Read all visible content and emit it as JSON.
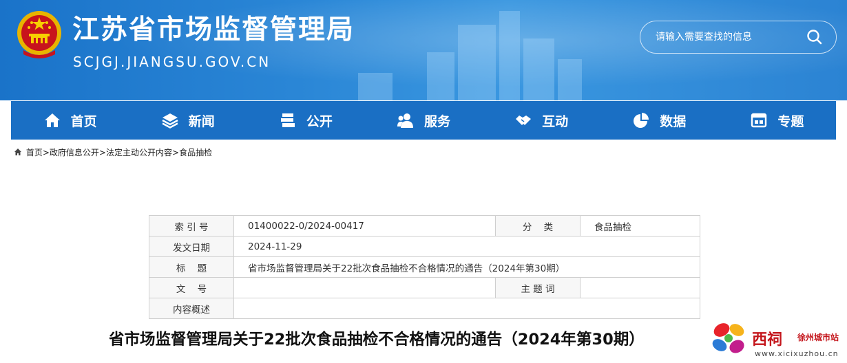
{
  "header": {
    "site_title": "江苏省市场监督管理局",
    "site_domain": "SCJGJ.JIANGSU.GOV.CN",
    "search_placeholder": "请输入需要查找的信息",
    "emblem_icon": "national-emblem-icon",
    "search_icon": "search-icon"
  },
  "nav": {
    "items": [
      {
        "label": "首页",
        "icon": "home-icon"
      },
      {
        "label": "新闻",
        "icon": "layers-icon"
      },
      {
        "label": "公开",
        "icon": "stack-icon"
      },
      {
        "label": "服务",
        "icon": "users-icon"
      },
      {
        "label": "互动",
        "icon": "handshake-icon"
      },
      {
        "label": "数据",
        "icon": "pie-chart-icon"
      },
      {
        "label": "专题",
        "icon": "window-icon"
      }
    ]
  },
  "breadcrumb": {
    "items": [
      "首页",
      "政府信息公开",
      "法定主动公开内容",
      "食品抽检"
    ],
    "separator": ">"
  },
  "meta": {
    "index_label": "索 引 号",
    "index_value": "01400022-0/2024-00417",
    "category_label": "分    类",
    "category_value": "食品抽检",
    "date_label": "发文日期",
    "date_value": "2024-11-29",
    "title_label": "标    题",
    "title_value": "省市场监督管理局关于22批次食品抽检不合格情况的通告（2024年第30期）",
    "doc_no_label": "文    号",
    "doc_no_value": "",
    "keywords_label": "主 题 词",
    "keywords_value": "",
    "summary_label": "内容概述",
    "summary_value": ""
  },
  "article": {
    "title": "省市场监督管理局关于22批次食品抽检不合格情况的通告（2024年第30期）"
  },
  "watermark": {
    "name": "西祠",
    "sub": "徐州城市站",
    "url": "www.xicixuzhou.cn"
  },
  "colors": {
    "banner": "#2a86d6",
    "nav": "#1a6fc4",
    "accent_red": "#c4161c"
  }
}
